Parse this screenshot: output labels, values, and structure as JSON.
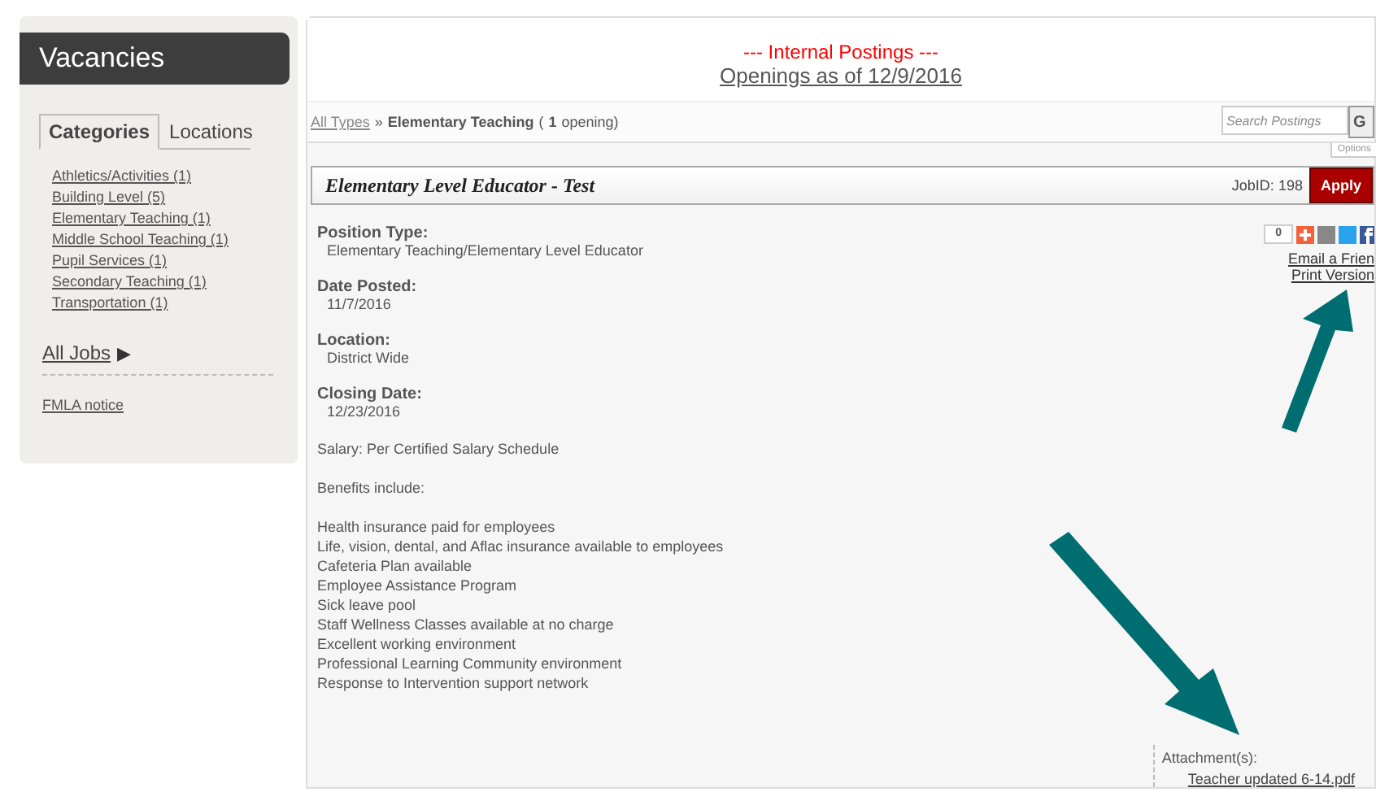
{
  "sidebar": {
    "title": "Vacancies",
    "tabs": [
      {
        "label": "Categories",
        "selected": true
      },
      {
        "label": "Locations",
        "selected": false
      }
    ],
    "categories": [
      "Athletics/Activities (1)",
      "Building Level (5)",
      "Elementary Teaching (1)",
      "Middle School Teaching (1)",
      "Pupil Services (1)",
      "Secondary Teaching (1)",
      "Transportation (1)"
    ],
    "all_jobs": "All Jobs",
    "all_jobs_arrow": "▶",
    "notice": "FMLA notice"
  },
  "header": {
    "banner": "--- Internal Postings ---",
    "subtitle": "Openings as of 12/9/2016"
  },
  "breadcrumb": {
    "root": "All Types",
    "separator": "»",
    "category": "Elementary Teaching",
    "count_open": "(",
    "count": "1",
    "count_rest": "opening)"
  },
  "search": {
    "placeholder": "Search Postings",
    "button": "G",
    "options": "Options"
  },
  "job": {
    "title": "Elementary Level Educator - Test",
    "job_id_label": "JobID:",
    "job_id": "198",
    "apply": "Apply",
    "share_count": "0",
    "links": [
      "Email a Frien",
      "Print Version"
    ],
    "fields": [
      {
        "label": "Position Type:",
        "value": "Elementary Teaching/Elementary Level Educator"
      },
      {
        "label": "Date Posted:",
        "value": "11/7/2016"
      },
      {
        "label": "Location:",
        "value": "District Wide"
      },
      {
        "label": "Closing Date:",
        "value": "12/23/2016"
      }
    ],
    "salary": "Salary:  Per Certified Salary Schedule",
    "benefits_heading": "Benefits include:",
    "benefits": [
      "Health insurance paid for employees",
      "Life, vision, dental, and Aflac insurance available to employees",
      "Cafeteria Plan available",
      "Employee Assistance Program",
      "Sick leave pool",
      "Staff Wellness Classes available at no charge",
      "Excellent working environment",
      "Professional Learning Community environment",
      "Response to Intervention support network"
    ],
    "attachments_label": "Attachment(s):",
    "attachment": "Teacher updated 6-14.pdf"
  }
}
